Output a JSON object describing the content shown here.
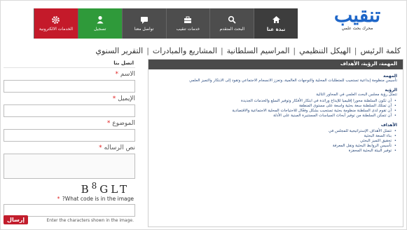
{
  "logo": {
    "word": "تنقيب",
    "tagline": "محرك بحث علمي"
  },
  "nav": [
    {
      "label": "نبذة عنا",
      "icon": "home-icon",
      "variant": "active"
    },
    {
      "label": "البحث المتقدم",
      "icon": "search-icon",
      "variant": ""
    },
    {
      "label": "خدمات تنقيب",
      "icon": "briefcase-icon",
      "variant": ""
    },
    {
      "label": "تواصل معنا",
      "icon": "chat-icon",
      "variant": ""
    },
    {
      "label": "تسجيل",
      "icon": "user-icon",
      "variant": "green"
    },
    {
      "label": "الخدمات الالكترونية",
      "icon": "gear-icon",
      "variant": "red"
    }
  ],
  "menu": [
    "كلمة الرئيس",
    "الهيكل التنظيمي",
    "المراسيم السلطانية",
    "المشاريع والمبادرات",
    "التقرير السنوي"
  ],
  "contact": {
    "title": "اتصل بنا",
    "name_label": "الاسم",
    "email_label": "الإيميل",
    "subject_label": "الموضوع",
    "message_label": "نص الرساله",
    "captcha_text": "B8GLT",
    "captcha_question": "?What code is in the image",
    "captcha_hint": "Enter the characters shown in the image.",
    "send_label": "إرسال"
  },
  "panel": {
    "title": "المهمة، الرؤية، الأهداف",
    "mission_title": "المهمة",
    "mission_text": "تأسيس منظومة إبداعية تستجيب للمتطلبات المحلية والتوجهات العالمية، وتعزز الانسجام الاجتماعي وتقود إلى الابتكار والتميز العلمي",
    "vision_title": "الرؤية",
    "vision_intro": "تتمثل رؤية مجلس البحث العلمي في المحاور التالية",
    "vision_items": [
      "أن تكون السلطنة محورا إقليميا للإبداع ورائدة في ابتكار الأفكار وتوفير السلع والخدمات الجديدة",
      "أن تمتلك السلطنة سعة بحثية واسعة على مستوى المنطقة",
      "أن تقوم لدى السلطنة منظومة بحثية تستجيب بشكل وفعّال للاحتياجات المحلية الاجتماعية والاقتصادية",
      "أن تتمكن السلطنة من توفير أبحاث السياسات المستنيرة المبنية على الأدلة"
    ],
    "goals_title": "الأهداف",
    "goals_items": [
      "تتمثل الأهداف الإستراتيجية للمجلس في",
      "بناء السعة البحثية",
      "تحقيق التميز البحثي",
      "تأسيس الروابط البحثية ونقل المعرفة",
      "توفير البيئة البحثية المحفزة"
    ]
  }
}
